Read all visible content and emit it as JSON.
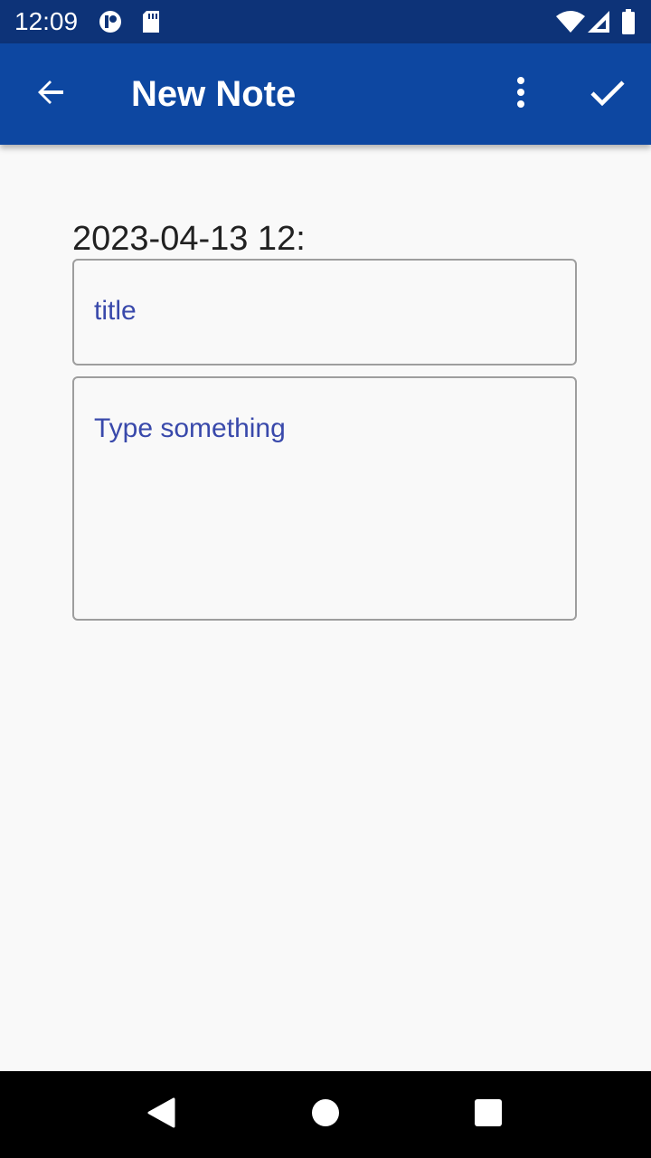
{
  "status_bar": {
    "time": "12:09",
    "icons": [
      "notification-app-icon",
      "sd-card-icon",
      "wifi-icon",
      "cell-signal-icon",
      "battery-icon"
    ]
  },
  "app_bar": {
    "title": "New Note",
    "back_icon": "arrow-back-icon",
    "menu_icon": "more-vert-icon",
    "save_icon": "check-icon",
    "background": "#0D47A1"
  },
  "note": {
    "date": "2023-04-13 12:",
    "title_placeholder": "title",
    "title_value": "",
    "body_placeholder": "Type something",
    "body_value": ""
  },
  "nav_bar": {
    "icons": [
      "back-triangle-icon",
      "home-circle-icon",
      "recents-square-icon"
    ]
  },
  "colors": {
    "status_bar": "#0D3378",
    "app_bar": "#0D47A1",
    "placeholder": "#3949AB",
    "background": "#F9F9F9"
  }
}
